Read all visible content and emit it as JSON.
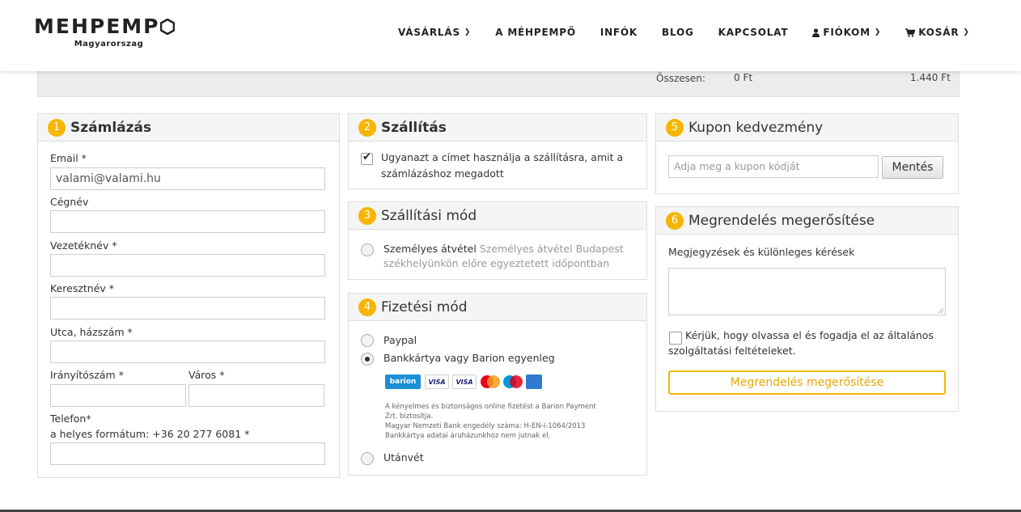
{
  "header": {
    "logo_main": "MEHPEMP",
    "logo_sub": "Magyarorszag",
    "nav": [
      {
        "label": "VÁSÁRLÁS",
        "chevron": true
      },
      {
        "label": "A MÉHPEMPŐ",
        "chevron": false
      },
      {
        "label": "INFÓK",
        "chevron": false
      },
      {
        "label": "BLOG",
        "chevron": false
      },
      {
        "label": "KAPCSOLAT",
        "chevron": false
      },
      {
        "label": "FIÓKOM",
        "chevron": true,
        "icon": "user-icon"
      },
      {
        "label": "KOSÁR",
        "chevron": true,
        "icon": "cart-icon"
      }
    ]
  },
  "summary": {
    "label": "Összesen:",
    "value1": "0 Ft",
    "value2": "1.440 Ft"
  },
  "billing": {
    "number": "1",
    "title": "Számlázás",
    "email_label": "Email *",
    "email_value": "valami@valami.hu",
    "company_label": "Cégnév",
    "lastname_label": "Vezetéknév *",
    "firstname_label": "Keresztnév *",
    "street_label": "Utca, házszám *",
    "zip_label": "Irányítószám *",
    "city_label": "Város *",
    "phone_label": "Telefon*",
    "phone_hint": "a helyes formátum: +36 20 277 6081 *"
  },
  "shipping": {
    "number": "2",
    "title": "Szállítás",
    "same_address_line1": "Ugyanazt a címet használja a szállításra, amit a",
    "same_address_line2": "számlázáshoz megadott"
  },
  "shipping_method": {
    "number": "3",
    "title": "Szállítási mód",
    "option_name": "Személyes átvétel",
    "option_desc_1": "Személyes átvétel Budapest",
    "option_desc_2": "székhelyünkön előre egyeztetett időpontban"
  },
  "payment": {
    "number": "4",
    "title": "Fizetési mód",
    "paypal": "Paypal",
    "card": "Bankkártya vagy Barion egyenleg",
    "cards": [
      "barion",
      "VISA",
      "VISA",
      "",
      "",
      ""
    ],
    "note_1": "A kényelmes és biztonságos online fizetést a Barion Payment",
    "note_2": "Zrt. biztosítja.",
    "note_3": "Magyar Nemzeti Bank engedély száma: H-EN-I-1064/2013",
    "note_4": "Bankkártya adatai áruházunkhoz nem jutnak el.",
    "cod": "Utánvét"
  },
  "coupon": {
    "number": "5",
    "title": "Kupon kedvezmény",
    "placeholder": "Adja meg a kupon kódját",
    "save": "Mentés"
  },
  "confirm": {
    "number": "6",
    "title": "Megrendelés megerősítése",
    "notes_label": "Megjegyzések és különleges kérések",
    "terms_line1": "Kérjük, hogy olvassa el és fogadja el az általános",
    "terms_line2": "szolgáltatási feltételeket.",
    "button": "Megrendelés megerősítése"
  },
  "colors": {
    "accent": "#f7b500",
    "barion": "#1a8fd6",
    "visa": "#1a1f71"
  }
}
